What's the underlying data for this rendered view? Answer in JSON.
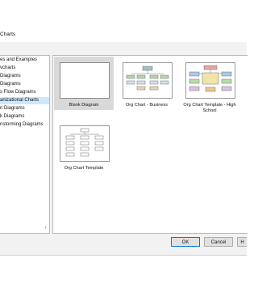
{
  "window": {
    "title": "Charts"
  },
  "tree": {
    "items": [
      {
        "label": "es and Examples",
        "selected": false
      },
      {
        "label": "vcharts",
        "selected": false
      },
      {
        "label": "Diagrams",
        "selected": false
      },
      {
        "label": "Diagrams",
        "selected": false
      },
      {
        "label": "s Flow Diagrams",
        "selected": false
      },
      {
        "label": "anizational Charts",
        "selected": true
      },
      {
        "label": "n Diagrams",
        "selected": false
      },
      {
        "label": "k Diagrams",
        "selected": false
      },
      {
        "label": "nstorming Diagrams",
        "selected": false
      }
    ]
  },
  "templates": [
    {
      "label": "Blank Diagram"
    },
    {
      "label": "Org Chart - Business"
    },
    {
      "label": "Org Chart Template - High School"
    },
    {
      "label": "Org Chart Template"
    }
  ],
  "buttons": {
    "ok": "OK",
    "cancel": "Cancel",
    "help": "H"
  },
  "colors": {
    "selection": "#cde8ff",
    "selected_tile": "#d9d9d9",
    "accent": "#0078d7"
  },
  "icons": {
    "scroll_right": "chevron-right-icon"
  }
}
